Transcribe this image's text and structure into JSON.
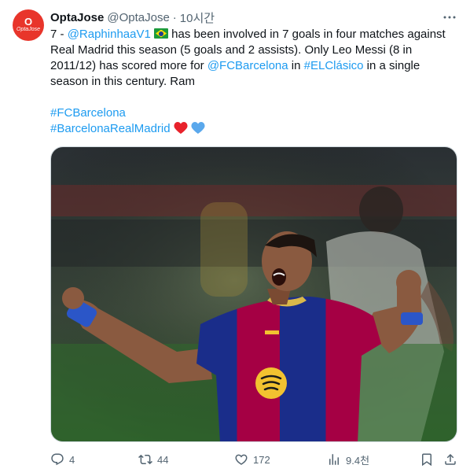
{
  "author": {
    "avatar_text_top": "O",
    "avatar_text_bottom": "OptaJose",
    "name": "OptaJose",
    "handle": "@OptaJose",
    "separator": "·",
    "time": "10시간"
  },
  "tweet": {
    "line1_prefix": "7 - ",
    "mention_raphinha": "@RaphinhaaV1",
    "line1_suffix": " has been involved in 7 goals in four matches against",
    "line2": "Real Madrid this season (5 goals and 2 assists). Only Leo Messi (8 in",
    "line3_prefix": "2011/12) has scored more for ",
    "mention_barca": "@FCBarcelona",
    "line3_mid": " in ",
    "hashtag_clasico": "#ELClásico",
    "line3_suffix": " in a single",
    "line4": "season in this century. Ram",
    "hashtag_barca": "#FCBarcelona",
    "hashtag_barca_rm": "#BarcelonaRealMadrid"
  },
  "media": {
    "jersey_colors": [
      "#a50044",
      "#1a2d8a"
    ],
    "description_icon": "celebrating-player-photo"
  },
  "actions": {
    "replies": "4",
    "reposts": "44",
    "likes": "172",
    "views": "9.4천"
  },
  "colors": {
    "link": "#1d9bf0",
    "secondary": "#536471",
    "heart_red": "#e8222b",
    "heart_blue": "#5aa8ec"
  }
}
